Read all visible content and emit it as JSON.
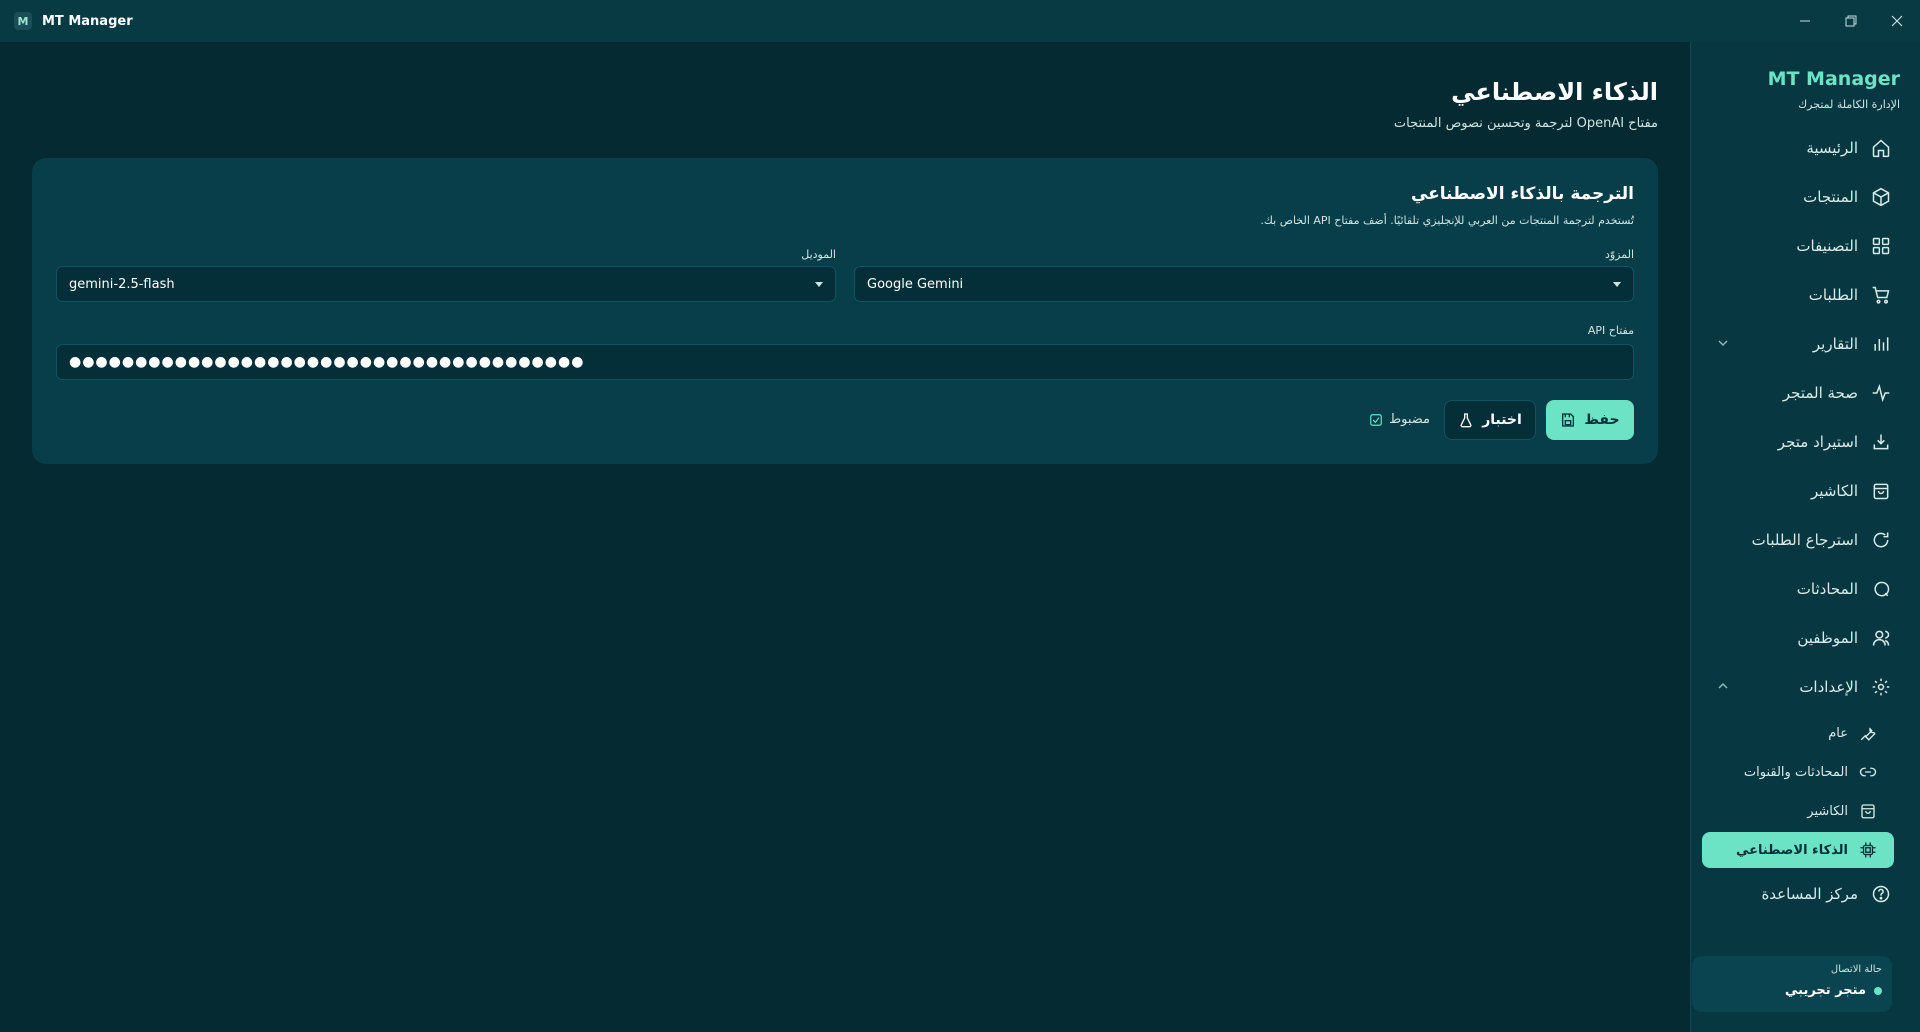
{
  "window": {
    "logo_letter": "M",
    "title": "MT Manager"
  },
  "sidebar": {
    "brand_title": "MT Manager",
    "brand_subtitle": "الإدارة الكاملة لمتجرك",
    "items": [
      {
        "label": "الرئيسية",
        "icon": "home-icon"
      },
      {
        "label": "المنتجات",
        "icon": "box-icon"
      },
      {
        "label": "التصنيفات",
        "icon": "grid-icon"
      },
      {
        "label": "الطلبات",
        "icon": "cart-icon"
      },
      {
        "label": "التقارير",
        "icon": "bar-chart-icon"
      },
      {
        "label": "صحة المتجر",
        "icon": "pulse-icon"
      },
      {
        "label": "استيراد متجر",
        "icon": "download-icon"
      },
      {
        "label": "الكاشير",
        "icon": "bag-icon"
      },
      {
        "label": "استرجاع الطلبات",
        "icon": "refresh-icon"
      },
      {
        "label": "المحادثات",
        "icon": "chat-icon"
      },
      {
        "label": "الموظفين",
        "icon": "users-icon"
      },
      {
        "label": "الإعدادات",
        "icon": "gear-icon"
      }
    ],
    "settings_sub": [
      {
        "label": "عام",
        "icon": "wrench-icon"
      },
      {
        "label": "المحادثات والقنوات",
        "icon": "link-icon"
      },
      {
        "label": "الكاشير",
        "icon": "bag-icon"
      },
      {
        "label": "الذكاء الاصطناعي",
        "icon": "chip-icon"
      }
    ],
    "help": {
      "label": "مركز المساعدة",
      "icon": "help-icon"
    },
    "connection": {
      "label": "حالة الاتصال",
      "store": "متجر تجريبي",
      "status_color": "#6be3c4"
    }
  },
  "main": {
    "title": "الذكاء الاصطناعي",
    "subtitle": "مفتاح OpenAI لترجمة وتحسين نصوص المنتجات",
    "card": {
      "title": "الترجمة بالذكاء الاصطناعي",
      "subtitle": "تُستخدم لترجمة المنتجات من العربي للإنجليزي تلقائيًا. أضف مفتاح API الخاص بك.",
      "provider_label": "المزوّد",
      "provider_value": "Google Gemini",
      "model_label": "الموديل",
      "model_value": "gemini-2.5-flash",
      "api_key_label": "مفتاح API",
      "api_key_value": "●●●●●●●●●●●●●●●●●●●●●●●●●●●●●●●●●●●●●●●",
      "save_label": "حفظ",
      "test_label": "اختبار",
      "status_label": "مضبوط"
    }
  },
  "colors": {
    "accent": "#6be3c4",
    "background": "#052a32",
    "sidebar": "#073842",
    "card": "#073e49"
  }
}
